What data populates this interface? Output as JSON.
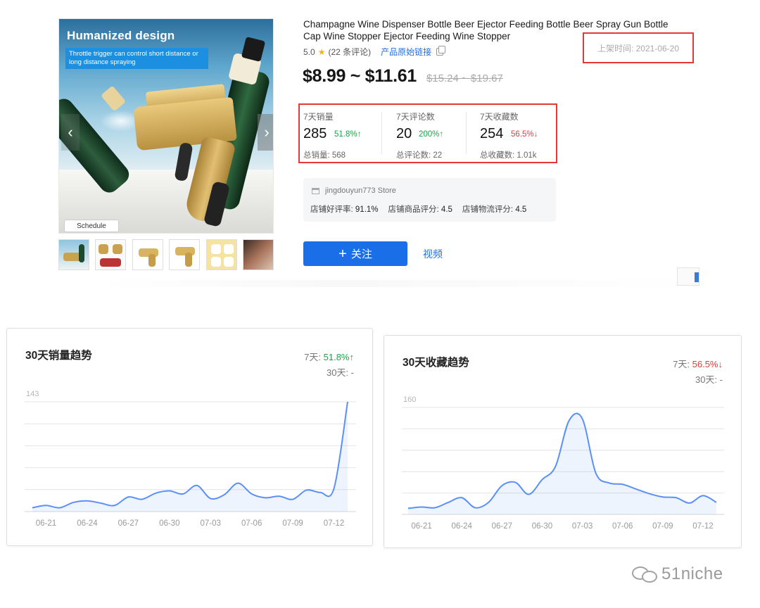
{
  "product": {
    "main_image": {
      "promo_title": "Humanized design",
      "promo_subtitle": "Throttle trigger can control short distance or long distance spraying",
      "schedule_label": "Schedule",
      "prev_arrow": "‹",
      "next_arrow": "›"
    },
    "thumbnail_count": 6,
    "title": "Champagne Wine Dispenser Bottle Beer Ejector Feeding Bottle Beer Spray Gun Bottle Cap Wine Stopper Ejector Feeding Wine Stopper",
    "rating": "5.0",
    "review_count": "(22 条评论)",
    "source_link": "产品原始链接",
    "listing_date": "上架时间: 2021-06-20",
    "price": "$8.99 ~ $11.61",
    "original_price": "$15.24 ~ $19.67",
    "stats": [
      {
        "label": "7天销量",
        "value": "285",
        "change": "51.8%↑",
        "trend": "up",
        "total": "总销量: 568"
      },
      {
        "label": "7天评论数",
        "value": "20",
        "change": "200%↑",
        "trend": "up",
        "total": "总评论数: 22"
      },
      {
        "label": "7天收藏数",
        "value": "254",
        "change": "56.5%↓",
        "trend": "down",
        "total": "总收藏数: 1.01k"
      }
    ],
    "store": {
      "name": "jingdouyun773 Store",
      "good_rate_label": "店铺好评率:",
      "good_rate": "91.1%",
      "product_score_label": "店铺商品评分:",
      "product_score": "4.5",
      "logistics_score_label": "店铺物流评分:",
      "logistics_score": "4.5"
    },
    "follow_button": "关注",
    "follow_icon": "plus-icon",
    "video_link": "视频"
  },
  "trend_panels": {
    "sales": {
      "title": "30天销量趋势",
      "seven_day_label": "7天: ",
      "seven_day_value": "51.8%↑",
      "thirty_day": "30天: -"
    },
    "favorites": {
      "title": "30天收藏趋势",
      "seven_day_label": "7天: ",
      "seven_day_value": "56.5%↓",
      "thirty_day": "30天: -"
    }
  },
  "chart_data": [
    {
      "type": "area",
      "title": "30天销量趋势",
      "xlabel": "",
      "ylabel": "",
      "ylim": [
        0,
        143
      ],
      "y_tick_labels": [
        "143"
      ],
      "x_tick_labels": [
        "06-21",
        "06-24",
        "06-27",
        "06-30",
        "07-03",
        "07-06",
        "07-09",
        "07-12"
      ],
      "x": [
        "06-20",
        "06-21",
        "06-22",
        "06-23",
        "06-24",
        "06-25",
        "06-26",
        "06-27",
        "06-28",
        "06-29",
        "06-30",
        "07-01",
        "07-02",
        "07-03",
        "07-04",
        "07-05",
        "07-06",
        "07-07",
        "07-08",
        "07-09",
        "07-10",
        "07-11",
        "07-12",
        "07-13"
      ],
      "values": [
        5,
        8,
        5,
        12,
        14,
        11,
        8,
        19,
        16,
        24,
        27,
        23,
        34,
        17,
        22,
        37,
        23,
        18,
        20,
        16,
        28,
        25,
        30,
        143
      ],
      "color": "#5b8ff9",
      "grid": true
    },
    {
      "type": "area",
      "title": "30天收藏趋势",
      "xlabel": "",
      "ylabel": "",
      "ylim": [
        0,
        160
      ],
      "y_tick_labels": [
        "160"
      ],
      "x_tick_labels": [
        "06-21",
        "06-24",
        "06-27",
        "06-30",
        "07-03",
        "07-06",
        "07-09",
        "07-12"
      ],
      "x": [
        "06-20",
        "06-21",
        "06-22",
        "06-23",
        "06-24",
        "06-25",
        "06-26",
        "06-27",
        "06-28",
        "06-29",
        "06-30",
        "07-01",
        "07-02",
        "07-03",
        "07-04",
        "07-05",
        "07-06",
        "07-07",
        "07-08",
        "07-09",
        "07-10",
        "07-11",
        "07-12",
        "07-13"
      ],
      "values": [
        9,
        11,
        10,
        18,
        25,
        10,
        18,
        43,
        48,
        30,
        52,
        72,
        140,
        143,
        62,
        47,
        45,
        38,
        31,
        26,
        25,
        17,
        28,
        18
      ],
      "color": "#5b8ff9",
      "grid": true
    }
  ],
  "watermark": "51niche",
  "colors": {
    "accent": "#1a6fe8",
    "up": "#1aa34a",
    "down": "#e53935",
    "highlight_border": "#e53935",
    "series": "#5b8ff9"
  }
}
